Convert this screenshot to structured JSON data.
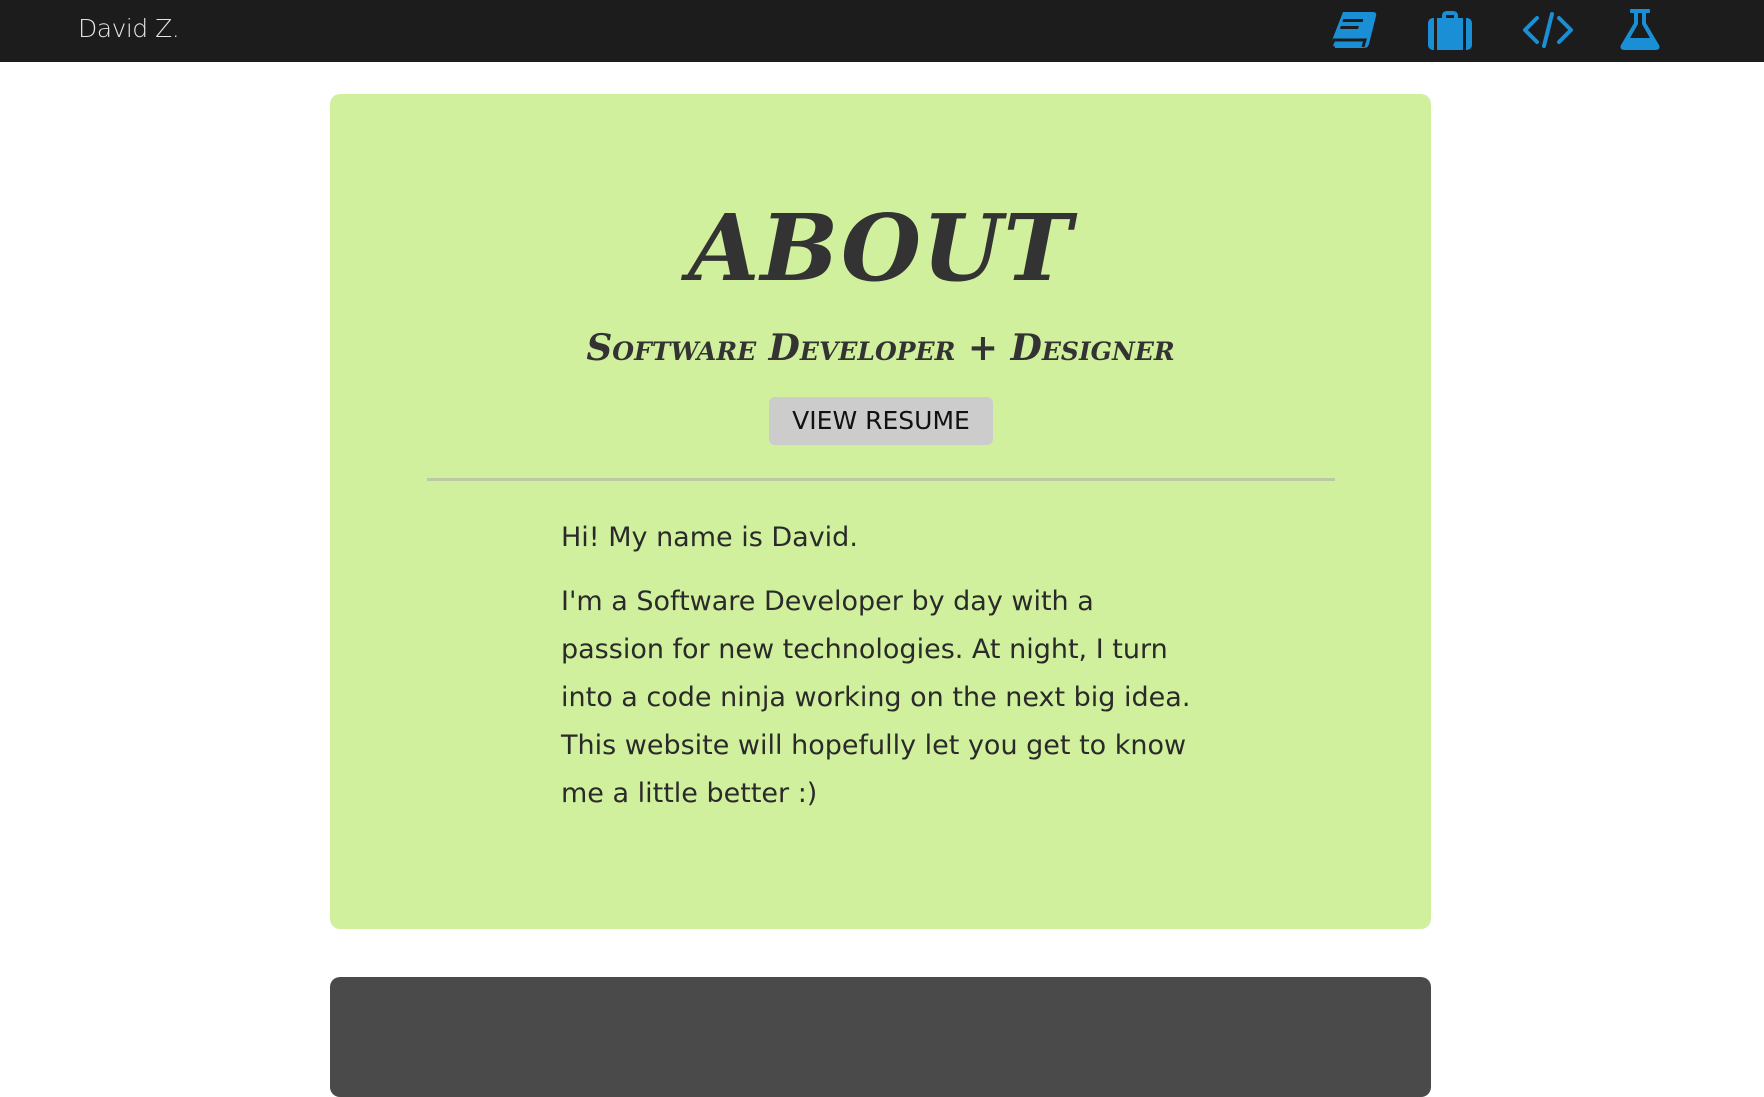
{
  "navbar": {
    "brand": "David Z.",
    "icons": [
      {
        "name": "book-icon",
        "color": "#1a8fd6"
      },
      {
        "name": "briefcase-icon",
        "color": "#1a8fd6"
      },
      {
        "name": "code-icon",
        "color": "#1a8fd6"
      },
      {
        "name": "flask-icon",
        "color": "#1a8fd6"
      }
    ]
  },
  "about": {
    "title": "ABOUT",
    "subtitle": "Software Developer + Designer",
    "resume_button": "VIEW RESUME",
    "greeting": "Hi! My name is David.",
    "bio": "I'm a Software Developer by day with a passion for new technologies. At night, I turn into a code ninja working on the next big idea. This website will hopefully let you get to know me a little better :)",
    "background": "#d1f09d"
  },
  "next_section": {
    "background": "#4a4a4a"
  }
}
